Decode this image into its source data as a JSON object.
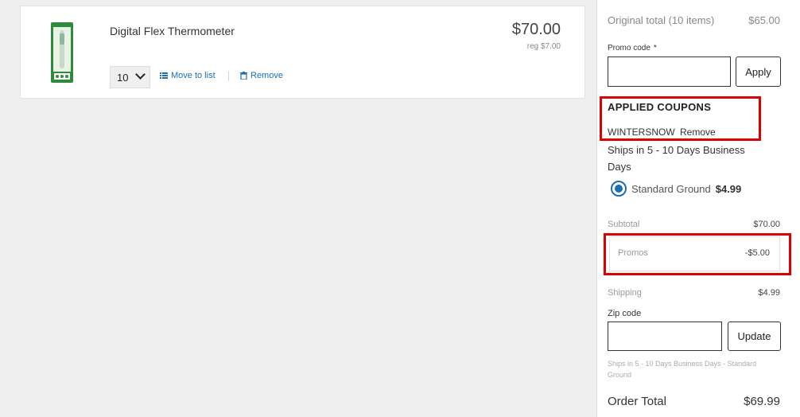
{
  "cart": {
    "item": {
      "name": "Digital Flex Thermometer",
      "price": "$70.00",
      "reg_price": "reg $7.00",
      "quantity": "10",
      "move_label": "Move to list",
      "remove_label": "Remove"
    }
  },
  "summary": {
    "original_total_label": "Original total (10 items)",
    "original_total_value": "$65.00",
    "promo_code_label": "Promo code",
    "promo_required_mark": "*",
    "promo_placeholder": "",
    "apply_label": "Apply",
    "applied_coupons_title": "APPLIED COUPONS",
    "coupon_code": "WINTERSNOW",
    "coupon_remove_label": "Remove",
    "ships_text": "Ships in 5 - 10 Days Business Days",
    "shipping_option_label": "Standard Ground",
    "shipping_option_price": "$4.99",
    "subtotal_label": "Subtotal",
    "subtotal_value": "$70.00",
    "promos_label": "Promos",
    "promos_value": "-$5.00",
    "shipping_label": "Shipping",
    "shipping_value": "$4.99",
    "zip_label": "Zip code",
    "zip_placeholder": "",
    "update_label": "Update",
    "ship_note": "Ships in 5 - 10 Days Business Days - Standard Ground",
    "order_total_label": "Order Total",
    "order_total_value": "$69.99"
  },
  "colors": {
    "link_blue": "#1a6fb5",
    "highlight_red": "#dd0000",
    "product_green": "#2e8b3c"
  }
}
